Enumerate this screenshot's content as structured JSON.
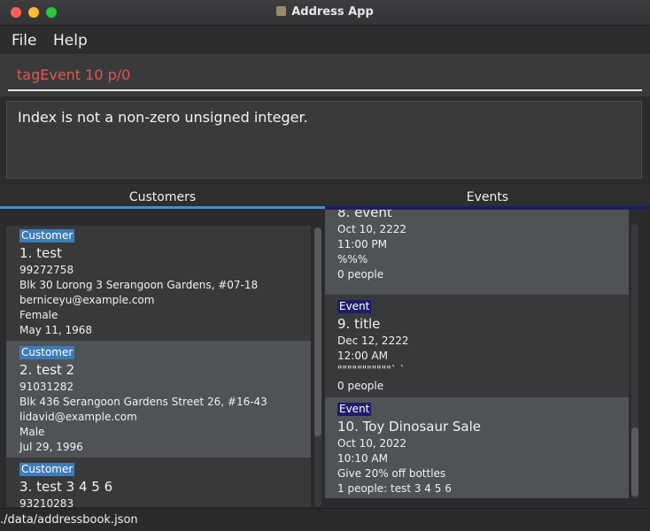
{
  "window": {
    "title": "Address App"
  },
  "menu": {
    "file": "File",
    "help": "Help"
  },
  "command": {
    "text": "tagEvent 10 p/0"
  },
  "result": {
    "text": "Index is not a non-zero unsigned integer."
  },
  "tabs": [
    {
      "label": "Customers"
    },
    {
      "label": "Events"
    }
  ],
  "customers": [
    {
      "tag": "Customer",
      "heading": "1.  test",
      "phone": "99272758",
      "address": "Blk 30 Lorong 3 Serangoon Gardens, #07-18",
      "email": "berniceyu@example.com",
      "gender": "Female",
      "birthday": "May 11, 1968"
    },
    {
      "tag": "Customer",
      "heading": "2.  test 2",
      "phone": "91031282",
      "address": "Blk 436 Serangoon Gardens Street 26, #16-43",
      "email": "lidavid@example.com",
      "gender": "Male",
      "birthday": "Jul 29, 1996"
    },
    {
      "tag": "Customer",
      "heading": "3.  test 3 4 5 6",
      "phone": "93210283"
    }
  ],
  "events": [
    {
      "heading": "8.  event",
      "date": "Oct 10, 2222",
      "time": "11:00 PM",
      "location": "%%%",
      "people": "0 people"
    },
    {
      "tag": "Event",
      "heading": "9.  title",
      "date": "Dec 12, 2222",
      "time": "12:00 AM",
      "location": "\"\"\"\"\"\"\"\"\"\"\"` `",
      "people": "0 people"
    },
    {
      "tag": "Event",
      "heading": "10.  Toy Dinosaur Sale",
      "date": "Oct 10, 2022",
      "time": "10:10 AM",
      "location": "Give 20% off bottles",
      "people": "1 people: test 3 4 5 6"
    }
  ],
  "status": {
    "path": "./data/addressbook.json"
  },
  "colors": {
    "command_text": "#e0584e",
    "customer_tag": "#3d7cba",
    "event_tag": "#1d1d6b",
    "customers_tab_accent": "#4a8ecc",
    "events_tab_accent": "#1a1a6e"
  }
}
